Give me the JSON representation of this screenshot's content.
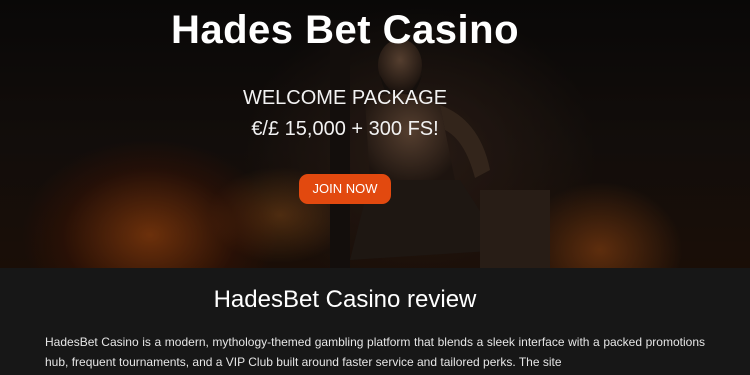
{
  "hero": {
    "title": "Hades Bet Casino",
    "subtitle_line1": "WELCOME PACKAGE",
    "subtitle_line2": "€/£ 15,000 + 300 FS!",
    "cta_label": "JOIN NOW",
    "cta_color": "#e2490f"
  },
  "review": {
    "title": "HadesBet Casino review",
    "body": "HadesBet Casino is a modern, mythology-themed gambling platform that blends a sleek interface with a packed promotions hub, frequent tournaments, and a VIP Club built around faster service and tailored perks. The site"
  }
}
